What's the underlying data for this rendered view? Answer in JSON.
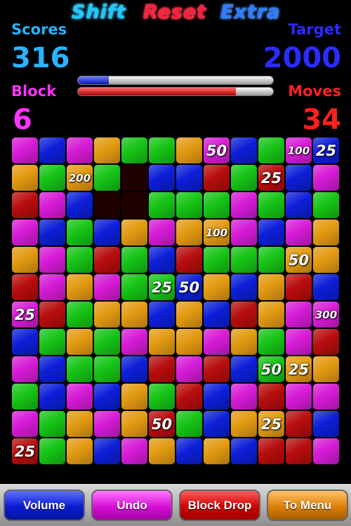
{
  "menu": {
    "shift": "Shift",
    "reset": "Reset",
    "extra": "Extra"
  },
  "stats": {
    "scores_label": "Scores",
    "scores_value": "316",
    "target_label": "Target",
    "target_value": "2000",
    "block_label": "Block",
    "block_value": "6",
    "moves_label": "Moves",
    "moves_value": "34",
    "scores_color": "#2ab3ff",
    "target_color": "#2b2bff",
    "block_color": "#ff34ff",
    "moves_color": "#ff2020"
  },
  "progress": {
    "score_fraction": 0.16,
    "moves_fraction": 0.81
  },
  "colors": {
    "M": "#d61bd6",
    "B": "#0c1fd8",
    "O": "#e39a12",
    "G": "#16c416",
    "R": "#b70d0d",
    "K": "#1e0000",
    "X": "#000000"
  },
  "board": {
    "rows": [
      [
        "M",
        "B",
        "M",
        "O",
        "G",
        "G",
        "O",
        "M",
        "B",
        "G",
        "M",
        "B"
      ],
      [
        "O",
        "G",
        "O",
        "G",
        "K",
        "B",
        "B",
        "R",
        "G",
        "R",
        "B",
        "M"
      ],
      [
        "R",
        "M",
        "B",
        "K",
        "K",
        "G",
        "G",
        "G",
        "M",
        "G",
        "B",
        "G"
      ],
      [
        "M",
        "B",
        "G",
        "B",
        "O",
        "M",
        "O",
        "O",
        "M",
        "B",
        "M",
        "O"
      ],
      [
        "O",
        "M",
        "G",
        "R",
        "G",
        "B",
        "R",
        "G",
        "G",
        "G",
        "O",
        "O"
      ],
      [
        "R",
        "M",
        "O",
        "M",
        "G",
        "G",
        "B",
        "O",
        "B",
        "O",
        "R",
        "B"
      ],
      [
        "M",
        "R",
        "G",
        "O",
        "O",
        "B",
        "O",
        "B",
        "R",
        "O",
        "M",
        "M"
      ],
      [
        "B",
        "G",
        "O",
        "G",
        "M",
        "O",
        "O",
        "M",
        "O",
        "G",
        "M",
        "R"
      ],
      [
        "M",
        "B",
        "G",
        "G",
        "B",
        "R",
        "M",
        "R",
        "B",
        "G",
        "O",
        "O"
      ],
      [
        "G",
        "B",
        "M",
        "B",
        "O",
        "G",
        "R",
        "B",
        "M",
        "R",
        "M",
        "M"
      ],
      [
        "M",
        "G",
        "O",
        "M",
        "O",
        "R",
        "G",
        "B",
        "O",
        "O",
        "R",
        "B"
      ],
      [
        "R",
        "G",
        "O",
        "B",
        "M",
        "O",
        "B",
        "O",
        "B",
        "R",
        "R",
        "M"
      ]
    ],
    "labels": {
      "0_7": "50",
      "0_10": "100",
      "0_11": "25",
      "1_2": "200",
      "1_9": "25",
      "3_7": "100",
      "4_10": "50",
      "5_5": "25",
      "5_6": "50",
      "6_0": "25",
      "6_11": "300",
      "8_9": "50",
      "8_10": "25",
      "10_5": "50",
      "10_9": "25",
      "11_0": "25"
    }
  },
  "bottom": {
    "volume": "Volume",
    "undo": "Undo",
    "block_drop": "Block Drop",
    "to_menu": "To Menu"
  }
}
